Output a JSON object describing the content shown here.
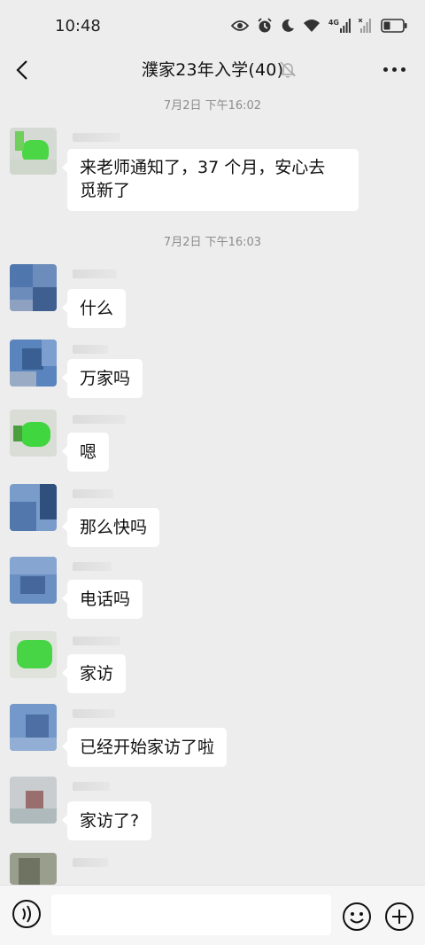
{
  "status_bar": {
    "time": "10:48",
    "network_label": "4G",
    "icons": [
      "eye-icon",
      "alarm-icon",
      "moon-icon",
      "wifi-icon",
      "signal-icon",
      "signal-x-icon",
      "battery-icon"
    ]
  },
  "header": {
    "title": "濮家23年入学(40)",
    "icons": [
      "back-arrow-icon",
      "mute-bell-icon",
      "more-icon"
    ]
  },
  "timestamps": [
    "7月2日 下午16:02",
    "7月2日 下午16:03"
  ],
  "messages": [
    {
      "text_line1": "来老师通知了，37 个月，安心去",
      "text_line2": "觅新了"
    },
    {
      "text": "什么"
    },
    {
      "text": "万家吗"
    },
    {
      "text": "嗯"
    },
    {
      "text": "那么快吗"
    },
    {
      "text": "电话吗"
    },
    {
      "text": "家访"
    },
    {
      "text": "已经开始家访了啦"
    },
    {
      "text": "家访了?"
    }
  ],
  "input_bar": {
    "icons": [
      "voice-icon",
      "emoji-icon",
      "plus-icon"
    ],
    "input_value": ""
  },
  "colors": {
    "background": "#ededed",
    "bubble": "#ffffff",
    "avatar_green": "#4cd44a",
    "avatar_blue": "#5b7fb0"
  }
}
